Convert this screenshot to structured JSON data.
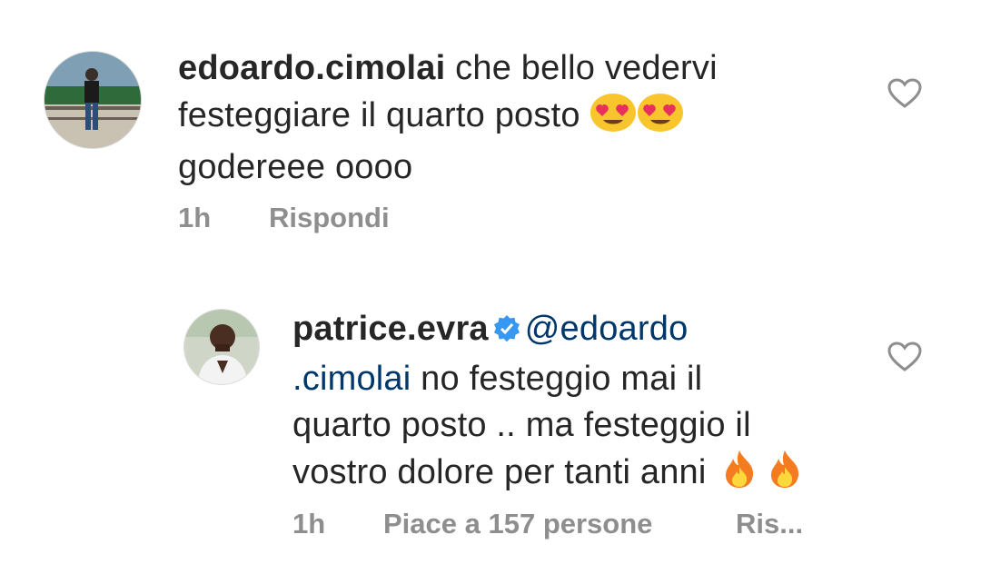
{
  "comments": [
    {
      "username": "edoardo.cimolai",
      "text_line1": " che bello vedervi",
      "text_line2": "festeggiare il quarto posto",
      "text_line3": "godereee oooo",
      "emoji_1": "smiling-face-with-heart-eyes",
      "emoji_2": "smiling-face-with-heart-eyes",
      "time": "1h",
      "reply_label": "Rispondi"
    },
    {
      "username": "patrice.evra",
      "verified": true,
      "mention_part1": "@edoardo",
      "mention_part2": ".cimolai",
      "text_line2_rest": " no festeggio mai il",
      "text_line3": "quarto posto .. ma festeggio il",
      "text_line4": "vostro dolore per tanti anni",
      "emoji_1": "fire",
      "emoji_2": "fire",
      "time": "1h",
      "likes_label": "Piace a 157 persone",
      "reply_label": "Ris..."
    }
  ],
  "colors": {
    "text": "#262626",
    "meta": "#8e8e8e",
    "mention": "#00376b",
    "verified": "#3897f0"
  }
}
